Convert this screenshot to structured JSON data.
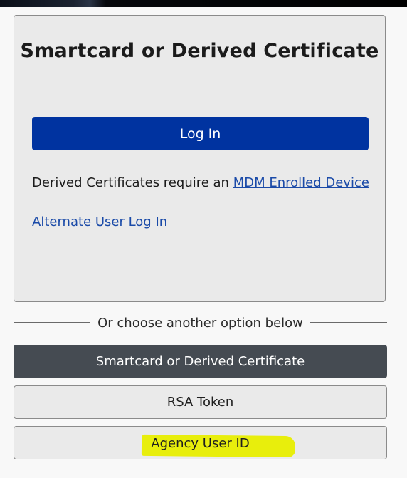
{
  "card": {
    "title": "Smartcard or Derived Certificate",
    "login_button": "Log In",
    "derived_text": "Derived Certificates require an ",
    "mdm_link": "MDM Enrolled Device",
    "alternate_link": "Alternate User Log In"
  },
  "divider": {
    "text": "Or choose another option below"
  },
  "options": {
    "smartcard": "Smartcard or Derived Certificate",
    "rsa": "RSA Token",
    "agency": "Agency User ID"
  },
  "colors": {
    "primary_button": "#0033a0",
    "active_option": "#454b52",
    "link": "#1a4aa8",
    "highlight": "#e8ee00"
  }
}
